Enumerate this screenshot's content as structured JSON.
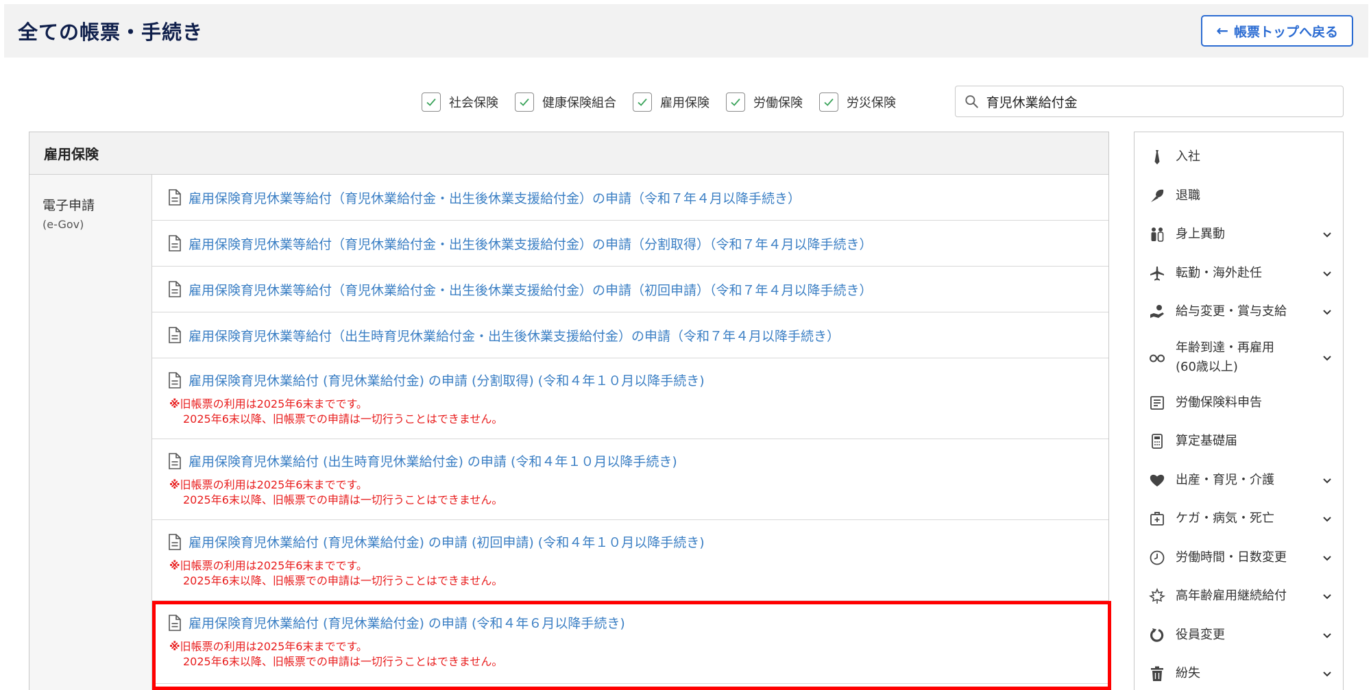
{
  "header": {
    "title": "全ての帳票・手続き",
    "back_label": "帳票トップへ戻る"
  },
  "filters": [
    {
      "label": "社会保険",
      "checked": true
    },
    {
      "label": "健康保険組合",
      "checked": true
    },
    {
      "label": "雇用保険",
      "checked": true
    },
    {
      "label": "労働保険",
      "checked": true
    },
    {
      "label": "労災保険",
      "checked": true
    }
  ],
  "search": {
    "value": "育児休業給付金"
  },
  "panel": {
    "title": "雇用保険",
    "category": {
      "name": "電子申請",
      "sub": "(e-Gov)"
    },
    "forms": [
      {
        "title": "雇用保険育児休業等給付（育児休業給付金・出生後休業支援給付金）の申請（令和７年４月以降手続き）"
      },
      {
        "title": "雇用保険育児休業等給付（育児休業給付金・出生後休業支援給付金）の申請（分割取得）（令和７年４月以降手続き）"
      },
      {
        "title": "雇用保険育児休業等給付（育児休業給付金・出生後休業支援給付金）の申請（初回申請）（令和７年４月以降手続き）"
      },
      {
        "title": "雇用保険育児休業等給付（出生時育児休業給付金・出生後休業支援給付金）の申請（令和７年４月以降手続き）"
      },
      {
        "title": "雇用保険育児休業給付 (育児休業給付金) の申請 (分割取得) (令和４年１０月以降手続き)",
        "mark": "※",
        "note1": "旧帳票の利用は2025年6末までです。",
        "note2": "2025年6末以降、旧帳票での申請は一切行うことはできません。"
      },
      {
        "title": "雇用保険育児休業給付 (出生時育児休業給付金) の申請 (令和４年１０月以降手続き)",
        "mark": "※",
        "note1": "旧帳票の利用は2025年6末までです。",
        "note2": "2025年6末以降、旧帳票での申請は一切行うことはできません。"
      },
      {
        "title": "雇用保険育児休業給付 (育児休業給付金) の申請 (初回申請) (令和４年１０月以降手続き)",
        "mark": "※",
        "note1": "旧帳票の利用は2025年6末までです。",
        "note2": "2025年6末以降、旧帳票での申請は一切行うことはできません。"
      },
      {
        "title": "雇用保険育児休業給付 (育児休業給付金) の申請 (令和４年６月以降手続き)",
        "mark": "※",
        "note1": "旧帳票の利用は2025年6末までです。",
        "note2": "2025年6末以降、旧帳票での申請は一切行うことはできません。"
      }
    ]
  },
  "side_nav": [
    {
      "label": "入社",
      "icon": "tie-icon",
      "expandable": false
    },
    {
      "label": "退職",
      "icon": "bouquet-icon",
      "expandable": false
    },
    {
      "label": "身上異動",
      "icon": "people-icon",
      "expandable": true
    },
    {
      "label": "転勤・海外赴任",
      "icon": "airplane-icon",
      "expandable": true
    },
    {
      "label": "給与変更・賞与支給",
      "icon": "money-hand-icon",
      "expandable": true
    },
    {
      "label": "年齢到達・再雇用",
      "label2": "(60歳以上)",
      "icon": "glasses-icon",
      "expandable": true
    },
    {
      "label": "労働保険料申告",
      "icon": "document-list-icon",
      "expandable": false
    },
    {
      "label": "算定基礎届",
      "icon": "calculator-icon",
      "expandable": false
    },
    {
      "label": "出産・育児・介護",
      "icon": "heart-icon",
      "expandable": true
    },
    {
      "label": "ケガ・病気・死亡",
      "icon": "first-aid-icon",
      "expandable": true
    },
    {
      "label": "労働時間・日数変更",
      "icon": "clock-icon",
      "expandable": true
    },
    {
      "label": "高年齢雇用継続給付",
      "icon": "maple-leaf-icon",
      "expandable": true
    },
    {
      "label": "役員変更",
      "icon": "refresh-icon",
      "expandable": true
    },
    {
      "label": "紛失",
      "icon": "trash-icon",
      "expandable": true
    }
  ],
  "colors": {
    "link": "#3b7fc4",
    "warning": "#e81c1c",
    "accent": "#2a6bd2",
    "highlight": "#ff0000",
    "check": "#3aa35a"
  }
}
